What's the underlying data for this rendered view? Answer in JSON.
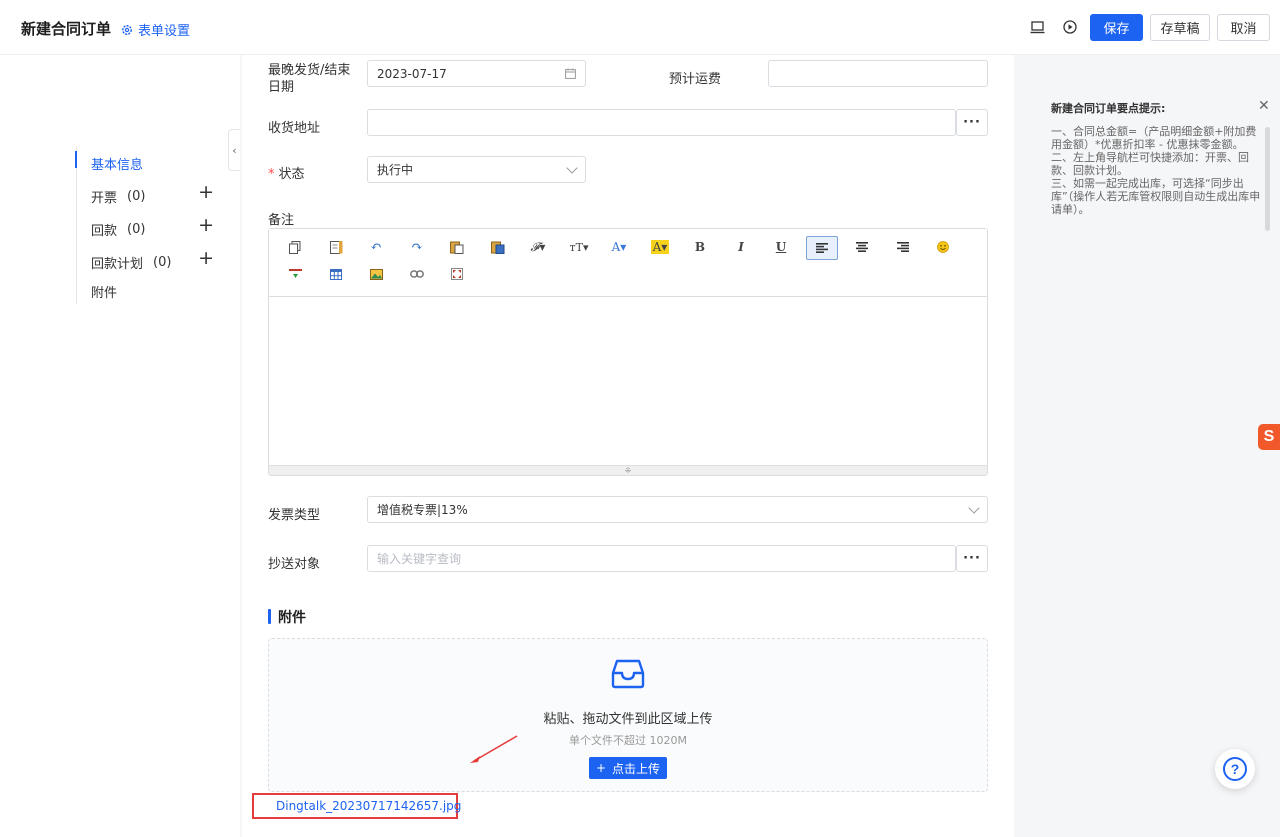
{
  "header": {
    "title": "新建合同订单",
    "form_settings": "表单设置",
    "save": "保存",
    "draft": "存草稿",
    "cancel": "取消"
  },
  "sidebar": {
    "items": [
      {
        "label": "基本信息",
        "count": "",
        "active": true
      },
      {
        "label": "开票",
        "count": "(0)"
      },
      {
        "label": "回款",
        "count": "(0)"
      },
      {
        "label": "回款计划",
        "count": "(0)"
      },
      {
        "label": "附件",
        "count": ""
      }
    ],
    "plus": "+"
  },
  "form": {
    "latest_delivery_label": "最晚发货/结束日期",
    "latest_delivery_value": "2023-07-17",
    "freight_label": "预计运费",
    "freight_value": "",
    "address_label": "收货地址",
    "address_value": "",
    "status_label": "状态",
    "status_required": "*",
    "status_value": "执行中",
    "remark_label": "备注",
    "invoice_type_label": "发票类型",
    "invoice_type_value": "增值税专票|13%",
    "cc_label": "抄送对象",
    "cc_placeholder": "输入关键字查询",
    "more": "···"
  },
  "editor": {
    "toolbar_row1": [
      "copy-icon",
      "paste-icon",
      "undo-icon",
      "redo-icon",
      "paste-text-icon",
      "paste-word-icon",
      "font-family-icon",
      "font-size-icon",
      "font-color-icon",
      "bg-color-icon",
      "bold-icon",
      "italic-icon",
      "underline-icon",
      "align-left-icon",
      "align-center-icon",
      "align-right-icon",
      "emoji-icon"
    ],
    "toolbar_row2": [
      "horizontal-rule-icon",
      "table-icon",
      "image-icon",
      "link-icon",
      "fullscreen-icon"
    ],
    "glyphs": {
      "font_family": "𝓕▾",
      "font_size": "ᴛT▾",
      "font_color": "A▾",
      "bg_color": "A▾",
      "bold": "B",
      "italic": "I",
      "underline": "U"
    }
  },
  "attachments": {
    "section_title": "附件",
    "upload_title": "粘贴、拖动文件到此区域上传",
    "upload_hint": "单个文件不超过 1020M",
    "upload_button": "点击上传",
    "file_name": "Dingtalk_20230717142657.jpg"
  },
  "tips": {
    "title": "新建合同订单要点提示:",
    "lines": [
      "一、合同总金额=（产品明细金额+附加费用金额）*优惠折扣率 - 优惠抹零金额。",
      "二、左上角导航栏可快捷添加：开票、回款、回款计划。",
      "三、如需一起完成出库，可选择“同步出库”（操作人若无库管权限则自动生成出库申请单）。"
    ]
  },
  "colors": {
    "accent": "#1d63f2",
    "required": "#ff4d4f",
    "annotation": "#e43b3b"
  },
  "misc": {
    "sogou_label": "S",
    "help_label": "?"
  }
}
